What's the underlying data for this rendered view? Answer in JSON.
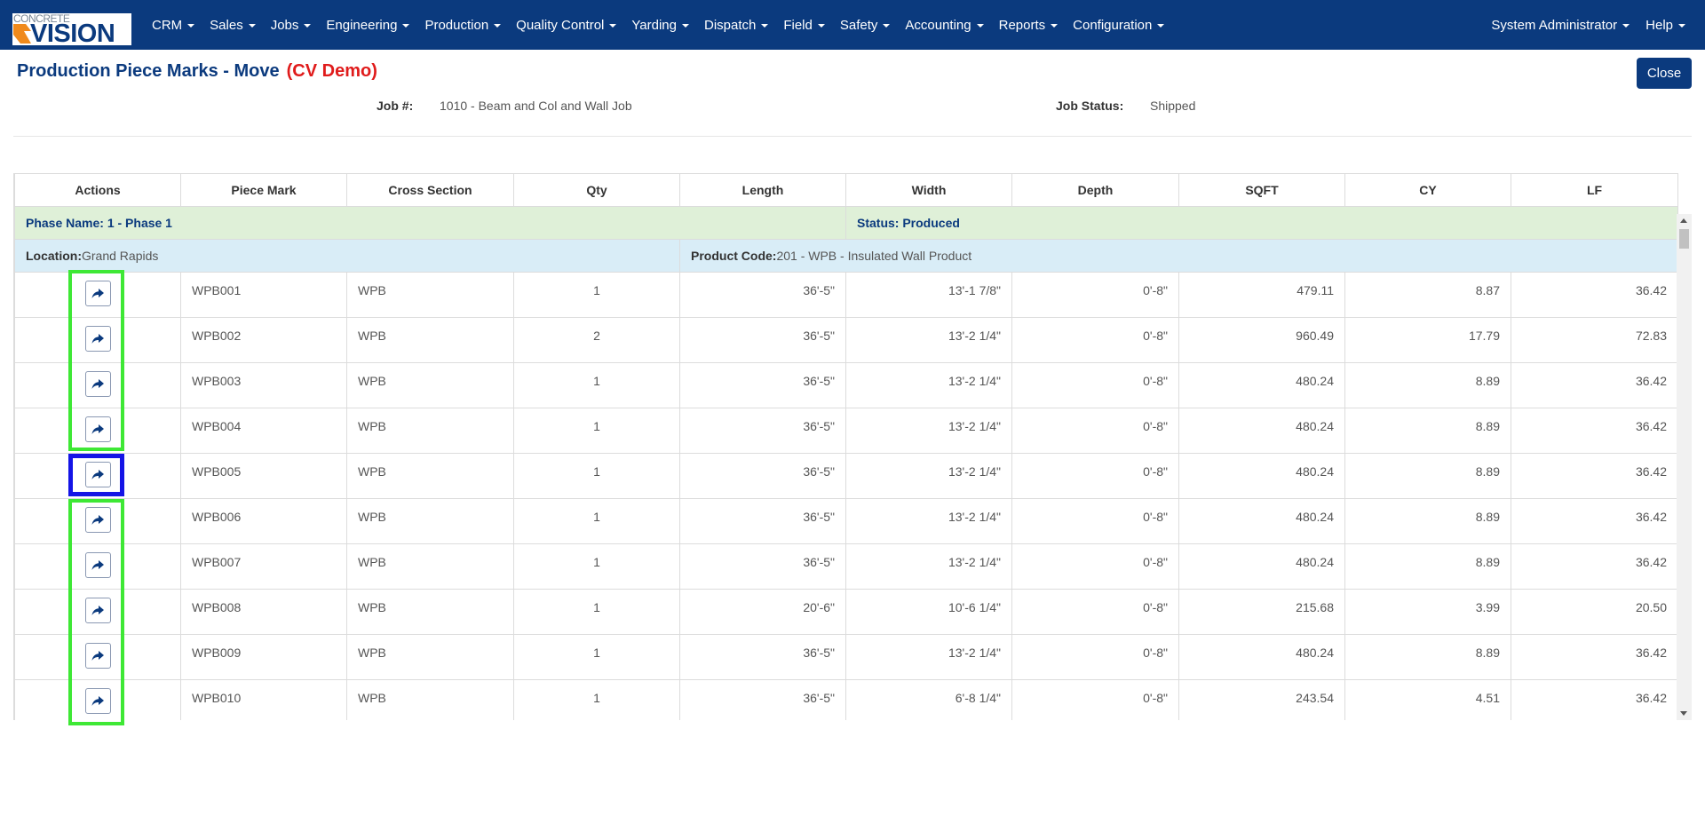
{
  "navbar": {
    "logo_top": "CONCRETE",
    "logo_main": "VISION",
    "menu": [
      "CRM",
      "Sales",
      "Jobs",
      "Engineering",
      "Production",
      "Quality Control",
      "Yarding",
      "Dispatch",
      "Field",
      "Safety",
      "Accounting",
      "Reports",
      "Configuration"
    ],
    "user": "System Administrator",
    "help": "Help"
  },
  "page": {
    "title": "Production Piece Marks - Move",
    "demo_tag": "(CV Demo)",
    "close_label": "Close"
  },
  "job": {
    "job_label": "Job #:",
    "job_value": "1010 - Beam and Col and Wall Job",
    "status_label": "Job Status:",
    "status_value": "Shipped"
  },
  "table": {
    "headers": [
      "Actions",
      "Piece Mark",
      "Cross Section",
      "Qty",
      "Length",
      "Width",
      "Depth",
      "SQFT",
      "CY",
      "LF"
    ],
    "phase_name": "Phase Name: 1 - Phase 1",
    "phase_status": "Status: Produced",
    "location_label": "Location:",
    "location_value": "Grand Rapids",
    "product_code_label": "Product Code:",
    "product_code_value": "201 - WPB - Insulated Wall Product",
    "rows": [
      {
        "mark": "WPB001",
        "section": "WPB",
        "qty": "1",
        "length": "36'-5\"",
        "width": "13'-1 7/8\"",
        "depth": "0'-8\"",
        "sqft": "479.11",
        "cy": "8.87",
        "lf": "36.42"
      },
      {
        "mark": "WPB002",
        "section": "WPB",
        "qty": "2",
        "length": "36'-5\"",
        "width": "13'-2 1/4\"",
        "depth": "0'-8\"",
        "sqft": "960.49",
        "cy": "17.79",
        "lf": "72.83"
      },
      {
        "mark": "WPB003",
        "section": "WPB",
        "qty": "1",
        "length": "36'-5\"",
        "width": "13'-2 1/4\"",
        "depth": "0'-8\"",
        "sqft": "480.24",
        "cy": "8.89",
        "lf": "36.42"
      },
      {
        "mark": "WPB004",
        "section": "WPB",
        "qty": "1",
        "length": "36'-5\"",
        "width": "13'-2 1/4\"",
        "depth": "0'-8\"",
        "sqft": "480.24",
        "cy": "8.89",
        "lf": "36.42"
      },
      {
        "mark": "WPB005",
        "section": "WPB",
        "qty": "1",
        "length": "36'-5\"",
        "width": "13'-2 1/4\"",
        "depth": "0'-8\"",
        "sqft": "480.24",
        "cy": "8.89",
        "lf": "36.42"
      },
      {
        "mark": "WPB006",
        "section": "WPB",
        "qty": "1",
        "length": "36'-5\"",
        "width": "13'-2 1/4\"",
        "depth": "0'-8\"",
        "sqft": "480.24",
        "cy": "8.89",
        "lf": "36.42"
      },
      {
        "mark": "WPB007",
        "section": "WPB",
        "qty": "1",
        "length": "36'-5\"",
        "width": "13'-2 1/4\"",
        "depth": "0'-8\"",
        "sqft": "480.24",
        "cy": "8.89",
        "lf": "36.42"
      },
      {
        "mark": "WPB008",
        "section": "WPB",
        "qty": "1",
        "length": "20'-6\"",
        "width": "10'-6 1/4\"",
        "depth": "0'-8\"",
        "sqft": "215.68",
        "cy": "3.99",
        "lf": "20.50"
      },
      {
        "mark": "WPB009",
        "section": "WPB",
        "qty": "1",
        "length": "36'-5\"",
        "width": "13'-2 1/4\"",
        "depth": "0'-8\"",
        "sqft": "480.24",
        "cy": "8.89",
        "lf": "36.42"
      },
      {
        "mark": "WPB010",
        "section": "WPB",
        "qty": "1",
        "length": "36'-5\"",
        "width": "6'-8 1/4\"",
        "depth": "0'-8\"",
        "sqft": "243.54",
        "cy": "4.51",
        "lf": "36.42"
      }
    ]
  },
  "colors": {
    "navbar": "#0b3a7e",
    "demo_tag": "#e01b1b",
    "phase_row": "#dff0d8",
    "location_row": "#d9edf7",
    "highlight_green": "#3ee835",
    "highlight_blue": "#1414e6"
  }
}
